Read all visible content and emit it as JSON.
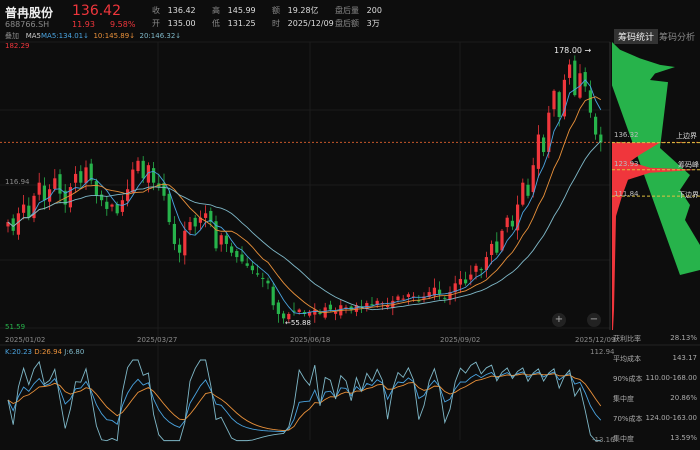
{
  "header": {
    "name": "普冉股份",
    "code": "688766.SH",
    "price": "136.42",
    "change": "11.93",
    "change_pct": "9.58%",
    "fields": [
      {
        "label": "收",
        "value": "136.42"
      },
      {
        "label": "高",
        "value": "145.99"
      },
      {
        "label": "额",
        "value": "19.28亿"
      },
      {
        "label": "盘后量",
        "value": "200"
      },
      {
        "label": "开",
        "value": "135.00"
      },
      {
        "label": "低",
        "value": "131.25"
      },
      {
        "label": "时",
        "value": "2025/12/09"
      },
      {
        "label": "盘后额",
        "value": "3万"
      }
    ]
  },
  "ma": {
    "overlay": "叠加",
    "ma5": "MA5:134.01↓",
    "ma10": "10:145.89↓",
    "ma20": "20:146.32↓"
  },
  "axis": {
    "top": "182.29",
    "mid": "116.94",
    "bottom": "51.59",
    "high_mark": "178.00 →",
    "low_mark": "←55.88",
    "dates": [
      "2025/01/02",
      "2025/03/27",
      "2025/06/18",
      "2025/09/02",
      "2025/12/09"
    ],
    "kdj_top": "112.94",
    "kdj_bottom": "-13.16"
  },
  "kdj": {
    "k": "K:20.23",
    "d": "D:26.94",
    "j": "J:6.80"
  },
  "chip": {
    "tabs": [
      "筹码统计",
      "筹码分析"
    ],
    "upper_value": "136.32",
    "upper_label": "上边界",
    "peak_value": "123.93",
    "peak_label": "筹码峰",
    "lower_value": "111.84",
    "lower_label": "下边界",
    "stats": [
      {
        "label": "获利比率",
        "value": "28.13%"
      },
      {
        "label": "平均成本",
        "value": "143.17"
      },
      {
        "label": "90%成本",
        "value": "110.00-168.00"
      },
      {
        "label": "集中度",
        "value": "20.86%"
      },
      {
        "label": "70%成本",
        "value": "124.00-163.00"
      },
      {
        "label": "集中度",
        "value": "13.59%"
      }
    ]
  },
  "zoom": {
    "in": "+",
    "out": "−"
  },
  "colors": {
    "up": "#f0363c",
    "down": "#27b34b",
    "ma5": "#4aa3df",
    "ma10": "#e8903a",
    "ma20": "#7fb8c8"
  },
  "chart_data": {
    "type": "candlestick",
    "ylim": [
      51.59,
      182.29
    ],
    "closes": [
      100,
      96,
      104,
      108,
      102,
      112,
      118,
      110,
      115,
      120,
      113,
      108,
      116,
      122,
      118,
      125,
      119,
      112,
      110,
      106,
      108,
      104,
      110,
      115,
      124,
      128,
      120,
      126,
      118,
      116,
      112,
      100,
      90,
      86,
      96,
      100,
      98,
      102,
      104,
      100,
      88,
      94,
      90,
      86,
      84,
      82,
      80,
      78,
      76,
      74,
      72,
      62,
      58,
      56,
      58,
      59,
      60,
      58,
      59,
      60,
      58,
      61,
      60,
      59,
      62,
      61,
      60,
      62,
      61,
      63,
      62,
      64,
      63,
      62,
      64,
      66,
      65,
      67,
      66,
      64,
      66,
      68,
      70,
      67,
      65,
      68,
      72,
      74,
      72,
      76,
      80,
      78,
      84,
      90,
      86,
      96,
      102,
      98,
      108,
      118,
      112,
      126,
      140,
      132,
      150,
      160,
      148,
      165,
      172,
      158,
      168,
      162,
      150,
      140,
      136.42
    ]
  }
}
